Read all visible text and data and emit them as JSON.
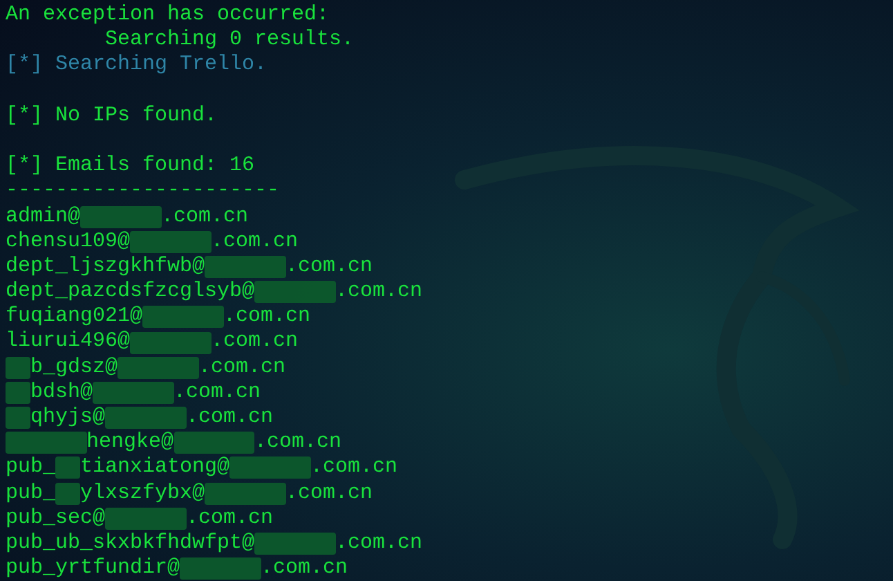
{
  "lines": [
    {
      "kind": "plain",
      "text": "An exception has occurred:"
    },
    {
      "kind": "plain",
      "text": "        Searching 0 results."
    },
    {
      "kind": "info",
      "text": "[*] Searching Trello."
    },
    {
      "kind": "blank"
    },
    {
      "kind": "plain",
      "text": "[*] No IPs found."
    },
    {
      "kind": "blank"
    },
    {
      "kind": "plain",
      "text": "[*] Emails found: 16"
    },
    {
      "kind": "plain",
      "text": "----------------------"
    }
  ],
  "emails": [
    {
      "segments": [
        {
          "kind": "text",
          "text": "admin@"
        },
        {
          "kind": "redacted"
        },
        {
          "kind": "text",
          "text": ".com.cn"
        }
      ]
    },
    {
      "segments": [
        {
          "kind": "text",
          "text": "chensu109@"
        },
        {
          "kind": "redacted"
        },
        {
          "kind": "text",
          "text": ".com.cn"
        }
      ]
    },
    {
      "segments": [
        {
          "kind": "text",
          "text": "dept_ljszgkhfwb@"
        },
        {
          "kind": "redacted"
        },
        {
          "kind": "text",
          "text": ".com.cn"
        }
      ]
    },
    {
      "segments": [
        {
          "kind": "text",
          "text": "dept_pazcdsfzcglsyb@"
        },
        {
          "kind": "redacted"
        },
        {
          "kind": "text",
          "text": ".com.cn"
        }
      ]
    },
    {
      "segments": [
        {
          "kind": "text",
          "text": "fuqiang021@"
        },
        {
          "kind": "redacted"
        },
        {
          "kind": "text",
          "text": ".com.cn"
        }
      ]
    },
    {
      "segments": [
        {
          "kind": "text",
          "text": "liurui496@"
        },
        {
          "kind": "redacted"
        },
        {
          "kind": "text",
          "text": ".com.cn"
        }
      ]
    },
    {
      "segments": [
        {
          "kind": "redacted-short"
        },
        {
          "kind": "text",
          "text": "b_gdsz@"
        },
        {
          "kind": "redacted"
        },
        {
          "kind": "text",
          "text": ".com.cn"
        }
      ]
    },
    {
      "segments": [
        {
          "kind": "redacted-short"
        },
        {
          "kind": "text",
          "text": "bdsh@"
        },
        {
          "kind": "redacted"
        },
        {
          "kind": "text",
          "text": ".com.cn"
        }
      ]
    },
    {
      "segments": [
        {
          "kind": "redacted-short"
        },
        {
          "kind": "text",
          "text": "qhyjs@"
        },
        {
          "kind": "redacted"
        },
        {
          "kind": "text",
          "text": ".com.cn"
        }
      ]
    },
    {
      "segments": [
        {
          "kind": "redacted"
        },
        {
          "kind": "text",
          "text": "hengke@"
        },
        {
          "kind": "redacted"
        },
        {
          "kind": "text",
          "text": ".com.cn"
        }
      ]
    },
    {
      "segments": [
        {
          "kind": "text",
          "text": "pub_"
        },
        {
          "kind": "redacted-short"
        },
        {
          "kind": "text",
          "text": "tianxiatong@"
        },
        {
          "kind": "redacted"
        },
        {
          "kind": "text",
          "text": ".com.cn"
        }
      ]
    },
    {
      "segments": [
        {
          "kind": "text",
          "text": "pub_"
        },
        {
          "kind": "redacted-short"
        },
        {
          "kind": "text",
          "text": "ylxszfybx@"
        },
        {
          "kind": "redacted"
        },
        {
          "kind": "text",
          "text": ".com.cn"
        }
      ]
    },
    {
      "segments": [
        {
          "kind": "text",
          "text": "pub_sec@"
        },
        {
          "kind": "redacted"
        },
        {
          "kind": "text",
          "text": ".com.cn"
        }
      ]
    },
    {
      "segments": [
        {
          "kind": "text",
          "text": "pub_ub_skxbkfhdwfpt@"
        },
        {
          "kind": "redacted"
        },
        {
          "kind": "text",
          "text": ".com.cn"
        }
      ]
    },
    {
      "segments": [
        {
          "kind": "text",
          "text": "pub_yrtfundir@"
        },
        {
          "kind": "redacted"
        },
        {
          "kind": "text",
          "text": ".com.cn"
        }
      ]
    }
  ]
}
